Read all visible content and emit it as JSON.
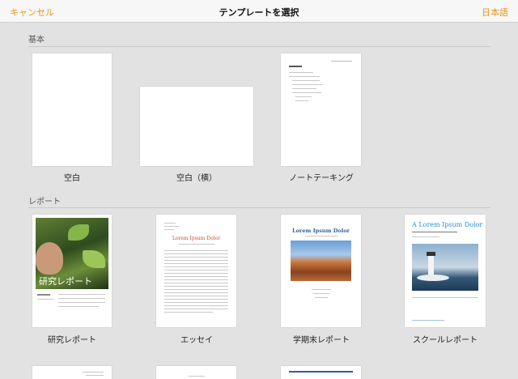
{
  "header": {
    "cancel_label": "キャンセル",
    "title": "テンプレートを選択",
    "language_label": "日本語"
  },
  "sections": {
    "basic": {
      "title": "基本",
      "templates": [
        {
          "name": "空白"
        },
        {
          "name": "空白（横）"
        },
        {
          "name": "ノートテーキング"
        }
      ]
    },
    "report": {
      "title": "レポート",
      "templates": [
        {
          "name": "研究レポート",
          "cover_text": "研究レポート"
        },
        {
          "name": "エッセイ",
          "heading": "Lorem Ipsum Dolor"
        },
        {
          "name": "学期末レポート",
          "heading": "Lorem Ipsum Dolor"
        },
        {
          "name": "スクールレポート",
          "heading": "A Lorem Ipsum Dolor"
        }
      ]
    }
  },
  "colors": {
    "accent": "#e8961b",
    "background": "#e2e2e2",
    "essay_heading": "#c0522f",
    "term_heading": "#2f5f9e",
    "school_heading": "#2b8fd0"
  }
}
